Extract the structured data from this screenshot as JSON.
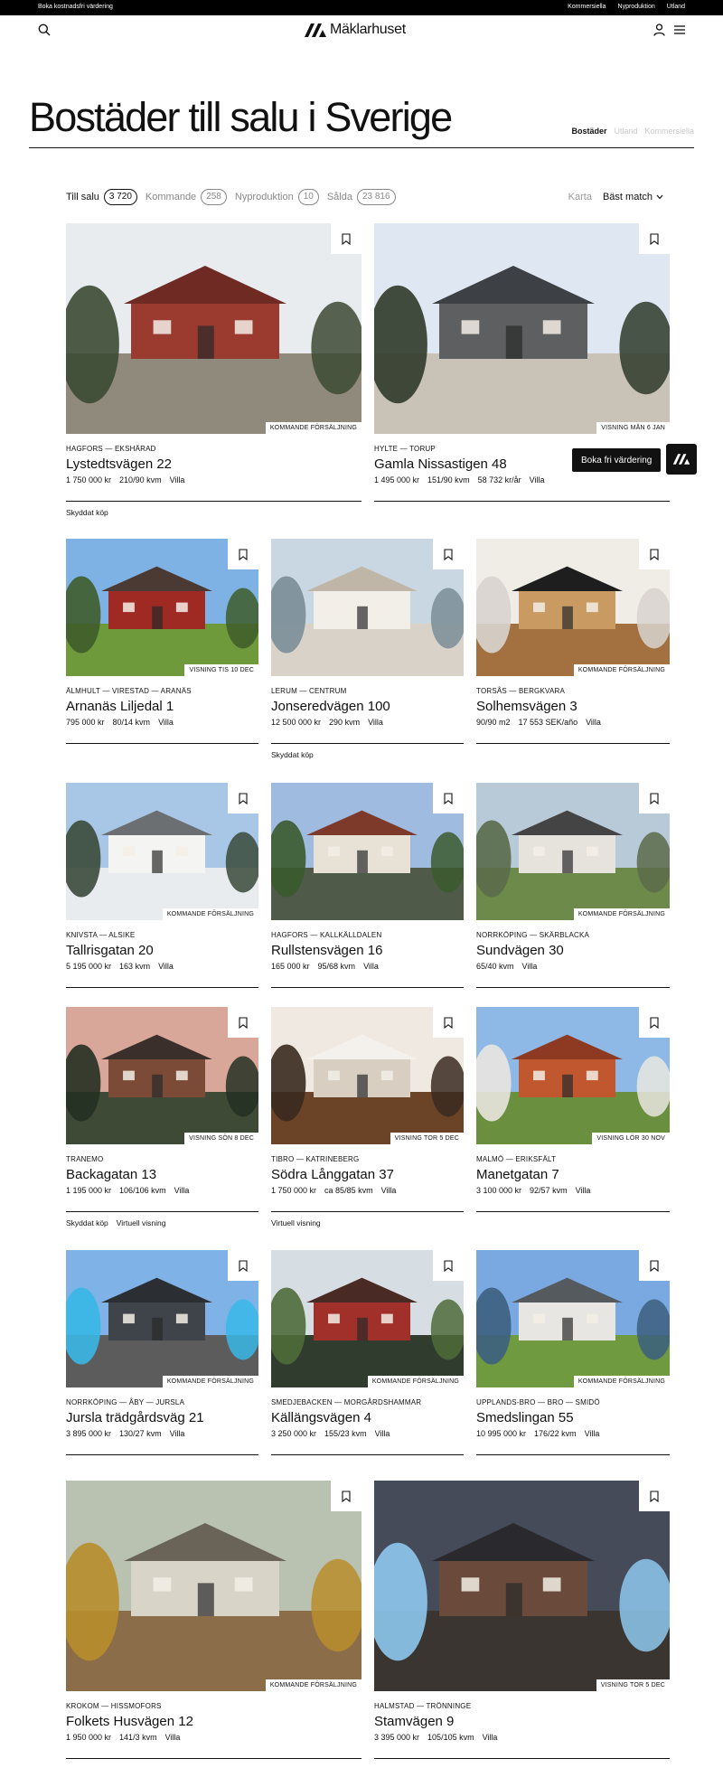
{
  "topbar": {
    "left_link": "Boka kostnadsfri värdering",
    "links": [
      "Kommersiella",
      "Nyproduktion",
      "Utland"
    ]
  },
  "header": {
    "logo_text": "Mäklarhuset",
    "icons": [
      "search-icon",
      "user-icon",
      "menu-icon"
    ]
  },
  "page": {
    "title": "Bostäder till salu i Sverige",
    "tabs": [
      "Bostäder",
      "Utland",
      "Kommersiella"
    ],
    "active_tab": "Bostäder"
  },
  "filters": [
    {
      "label": "Till salu",
      "count": "3 720",
      "active": true
    },
    {
      "label": "Kommande",
      "count": "258",
      "active": false
    },
    {
      "label": "Nyproduktion",
      "count": "10",
      "active": false
    },
    {
      "label": "Sålda",
      "count": "23 816",
      "active": false
    }
  ],
  "sort": {
    "map_label": "Karta",
    "sort_label": "Bäst match"
  },
  "floating": {
    "cta_label": "Boka fri värdering"
  },
  "listings": [
    {
      "location": "HAGFORS — EKSHÄRAD",
      "name": "Lystedtsvägen 22",
      "meta": [
        "1 750 000 kr",
        "210/90 kvm",
        "Villa"
      ],
      "badge": "KOMMANDE FÖRSÄLJNING",
      "tags": [
        "Skyddat köp"
      ]
    },
    {
      "location": "HYLTE — TORUP",
      "name": "Gamla Nissastigen 48",
      "meta": [
        "1 495 000 kr",
        "151/90 kvm",
        "58 732 kr/år",
        "Villa"
      ],
      "badge": "VISNING MÅN 6 JAN",
      "tags": []
    },
    {
      "location": "ÄLMHULT — VIRESTAD — ARANÄS",
      "name": "Arnanäs Liljedal 1",
      "meta": [
        "795 000 kr",
        "80/14 kvm",
        "Villa"
      ],
      "badge": "VISNING TIS 10 DEC",
      "tags": []
    },
    {
      "location": "LERUM — CENTRUM",
      "name": "Jonseredvägen 100",
      "meta": [
        "12 500 000 kr",
        "290 kvm",
        "Villa"
      ],
      "badge": "",
      "tags": [
        "Skyddat köp"
      ]
    },
    {
      "location": "TORSÅS — BERGKVARA",
      "name": "Solhemsvägen 3",
      "meta": [
        "90/90 m2",
        "17 553 SEK/año",
        "Villa"
      ],
      "badge": "KOMMANDE FÖRSÄLJNING",
      "tags": []
    },
    {
      "location": "KNIVSTA — ALSIKE",
      "name": "Tallrisgatan 20",
      "meta": [
        "5 195 000 kr",
        "163 kvm",
        "Villa"
      ],
      "badge": "KOMMANDE FÖRSÄLJNING",
      "tags": []
    },
    {
      "location": "HAGFORS — KALLKÄLLDALEN",
      "name": "Rullstensvägen 16",
      "meta": [
        "165 000 kr",
        "95/68 kvm",
        "Villa"
      ],
      "badge": "",
      "tags": []
    },
    {
      "location": "NORRKÖPING — SKÄRBLACKA",
      "name": "Sundvägen 30",
      "meta": [
        "65/40 kvm",
        "Villa"
      ],
      "badge": "KOMMANDE FÖRSÄLJNING",
      "tags": []
    },
    {
      "location": "TRANEMO",
      "name": "Backagatan 13",
      "meta": [
        "1 195 000 kr",
        "106/106 kvm",
        "Villa"
      ],
      "badge": "VISNING SÖN 8 DEC",
      "tags": [
        "Skyddat köp",
        "Virtuell visning"
      ]
    },
    {
      "location": "TIBRO — KATRINEBERG",
      "name": "Södra Långgatan 37",
      "meta": [
        "1 750 000 kr",
        "ca 85/85 kvm",
        "Villa"
      ],
      "badge": "VISNING TOR 5 DEC",
      "tags": [
        "Virtuell visning"
      ]
    },
    {
      "location": "MALMÖ — ERIKSFÄLT",
      "name": "Manetgatan 7",
      "meta": [
        "3 100 000 kr",
        "92/57 kvm",
        "Villa"
      ],
      "badge": "VISNING LÖR 30 NOV",
      "tags": []
    },
    {
      "location": "NORRKÖPING — ÅBY — JURSLA",
      "name": "Jursla trädgårdsväg 21",
      "meta": [
        "3 895 000 kr",
        "130/27 kvm",
        "Villa"
      ],
      "badge": "KOMMANDE FÖRSÄLJNING",
      "tags": []
    },
    {
      "location": "SMEDJEBACKEN — MORGÅRDSHAMMAR",
      "name": "Källängsvägen 4",
      "meta": [
        "3 250 000 kr",
        "155/23 kvm",
        "Villa"
      ],
      "badge": "KOMMANDE FÖRSÄLJNING",
      "tags": []
    },
    {
      "location": "UPPLANDS-BRO — BRO — SMIDÖ",
      "name": "Smedslingan 55",
      "meta": [
        "10 995 000 kr",
        "176/22 kvm",
        "Villa"
      ],
      "badge": "KOMMANDE FÖRSÄLJNING",
      "tags": []
    },
    {
      "location": "KROKOM — HISSMOFORS",
      "name": "Folkets Husvägen 12",
      "meta": [
        "1 950 000 kr",
        "141/3 kvm",
        "Villa"
      ],
      "badge": "KOMMANDE FÖRSÄLJNING",
      "tags": []
    },
    {
      "location": "HALMSTAD — TRÖNNINGE",
      "name": "Stamvägen 9",
      "meta": [
        "3 395 000 kr",
        "105/105 kvm",
        "Villa"
      ],
      "badge": "VISNING TOR 5 DEC",
      "tags": []
    }
  ],
  "scene_palettes": [
    {
      "sky": "#e9ecef",
      "ground": "#8f8a7c",
      "house": "#9b3b2f",
      "roof": "#6e2a23",
      "accent": "#3c4a33"
    },
    {
      "sky": "#dfe8f2",
      "ground": "#c9c2b6",
      "house": "#5d5f60",
      "roof": "#3d4044",
      "accent": "#2f3a2a"
    },
    {
      "sky": "#7fb2e4",
      "ground": "#6f9a3c",
      "house": "#9f2a24",
      "roof": "#4a3a33",
      "accent": "#3e5c2a"
    },
    {
      "sky": "#c9d7e2",
      "ground": "#d9d2c8",
      "house": "#f2efe9",
      "roof": "#bfb6a8",
      "accent": "#7a8e98"
    },
    {
      "sky": "#f0ece6",
      "ground": "#a3703f",
      "house": "#c99a62",
      "roof": "#1e1e1e",
      "accent": "#d8d4cf"
    },
    {
      "sky": "#a8c6e6",
      "ground": "#e8ecef",
      "house": "#f4f4f2",
      "roof": "#6b6f72",
      "accent": "#3a4a3a"
    },
    {
      "sky": "#9fbbe0",
      "ground": "#4f5a49",
      "house": "#e8e1d6",
      "roof": "#7d3a2a",
      "accent": "#3a5a2e"
    },
    {
      "sky": "#b8c9d8",
      "ground": "#6e8a4a",
      "house": "#e6e2dc",
      "roof": "#444",
      "accent": "#5a6b4a"
    },
    {
      "sky": "#d9a79a",
      "ground": "#3e4a35",
      "house": "#7b4b38",
      "roof": "#3a2f2a",
      "accent": "#233022"
    },
    {
      "sky": "#efe9e1",
      "ground": "#6b4428",
      "house": "#d8cfc2",
      "roof": "#f4f1ec",
      "accent": "#3a2a20"
    },
    {
      "sky": "#8eb9e6",
      "ground": "#6a8f3f",
      "house": "#c1572f",
      "roof": "#8e3a22",
      "accent": "#e9e6df"
    },
    {
      "sky": "#7fb3e8",
      "ground": "#5c5c5c",
      "house": "#3f444b",
      "roof": "#2b2e33",
      "accent": "#38b7e6"
    },
    {
      "sky": "#d6dde3",
      "ground": "#2f3c2e",
      "house": "#a2302a",
      "roof": "#4a2a24",
      "accent": "#4f6b3a"
    },
    {
      "sky": "#79a9e0",
      "ground": "#6f9a3f",
      "house": "#e8e6e2",
      "roof": "#555a5e",
      "accent": "#3c5f7f"
    },
    {
      "sky": "#b9c2b0",
      "ground": "#8c6d4a",
      "house": "#d9d4c8",
      "roof": "#6a6458",
      "accent": "#b88d2b"
    },
    {
      "sky": "#454b58",
      "ground": "#3a3530",
      "house": "#6a4a3a",
      "roof": "#2a2a2e",
      "accent": "#8ec8ef"
    }
  ]
}
